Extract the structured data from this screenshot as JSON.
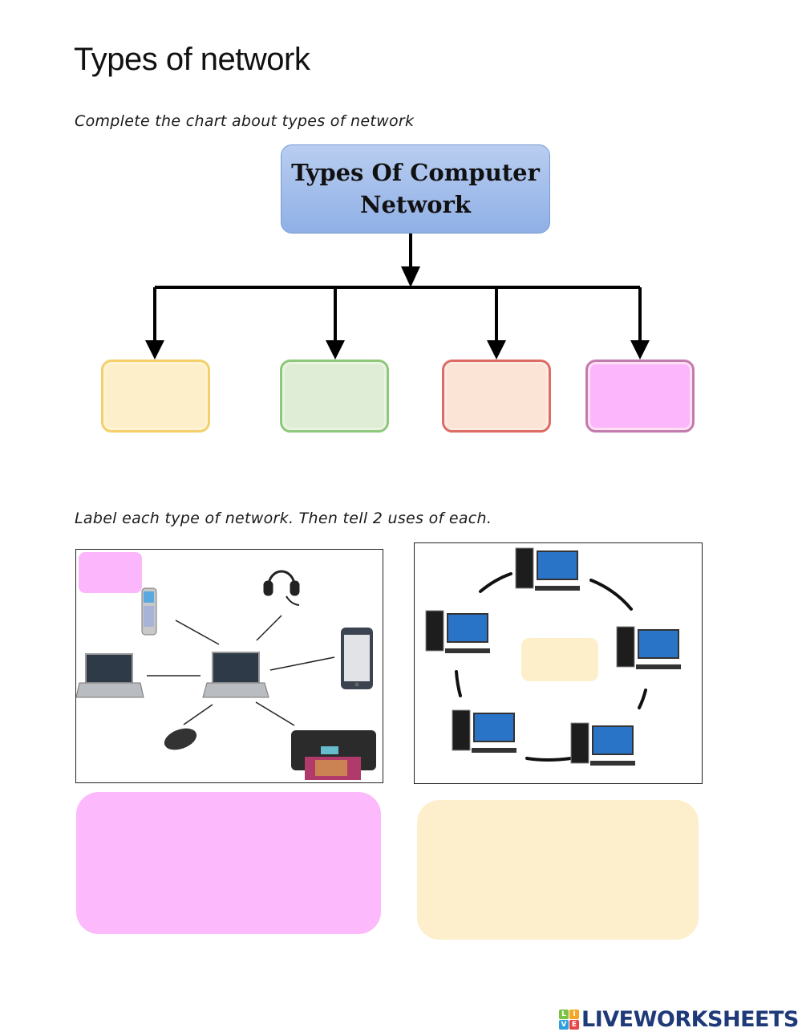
{
  "page": {
    "title": "Types of network",
    "instruction_1": "Complete the chart about types of network",
    "instruction_2": "Label each type of network. Then tell 2 uses of each."
  },
  "chart": {
    "root": {
      "line1": "Types Of Computer",
      "line2": "Network"
    },
    "branches": [
      {
        "label": "",
        "fill": "#fdefc9",
        "border": "#f5cf6a"
      },
      {
        "label": "",
        "fill": "#dfedd6",
        "border": "#8ec87a"
      },
      {
        "label": "",
        "fill": "#fbe3d6",
        "border": "#de6a66"
      },
      {
        "label": "",
        "fill": "#fcb6fb",
        "border": "#c27cab"
      }
    ]
  },
  "images": {
    "left": {
      "description": "Personal area network: central laptop connected to phone, headset, smartphone, laptop, mouse, printer",
      "label_box": {
        "value": "",
        "fill": "#fcb6fb"
      },
      "devices": [
        "cordless-phone",
        "headset",
        "smartphone",
        "laptop",
        "mouse",
        "printer",
        "central-laptop"
      ]
    },
    "right": {
      "description": "Ring of five desktop computers",
      "label_box": {
        "value": "",
        "fill": "#fdefc9"
      },
      "devices": [
        "desktop-1",
        "desktop-2",
        "desktop-3",
        "desktop-4",
        "desktop-5"
      ]
    }
  },
  "answers": {
    "left": {
      "value": "",
      "fill": "#fcb9fb"
    },
    "right": {
      "value": "",
      "fill": "#fdefcc"
    }
  },
  "footer": {
    "logo_cubes": [
      {
        "letter": "L",
        "color": "#7cc242"
      },
      {
        "letter": "I",
        "color": "#f6a623"
      },
      {
        "letter": "V",
        "color": "#2e9fdc"
      },
      {
        "letter": "E",
        "color": "#e84646"
      }
    ],
    "brand": "LIVEWORKSHEETS",
    "brand_color": "#1f3a78"
  }
}
